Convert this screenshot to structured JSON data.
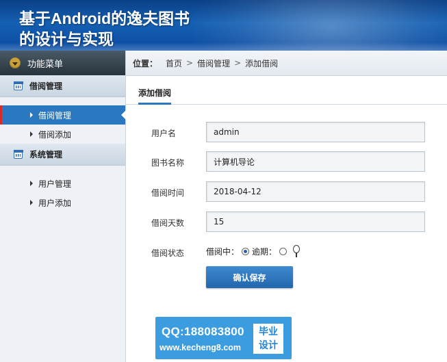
{
  "header": {
    "title_line1": "基于Android的逸夫图书",
    "title_line2": "的设计与实现"
  },
  "sidebar": {
    "menu_title": "功能菜单",
    "groups": [
      {
        "label": "借阅管理",
        "items": [
          {
            "label": "借阅管理",
            "active": true
          },
          {
            "label": "借阅添加"
          }
        ]
      },
      {
        "label": "系统管理",
        "items": [
          {
            "label": "用户管理"
          },
          {
            "label": "用户添加"
          }
        ]
      }
    ]
  },
  "breadcrumb": {
    "position_label": "位置：",
    "items": [
      "首页",
      "借阅管理",
      "添加借阅"
    ],
    "separator": ">"
  },
  "tab": {
    "label": "添加借阅"
  },
  "form": {
    "username": {
      "label": "用户名",
      "value": "admin"
    },
    "book_name": {
      "label": "图书名称",
      "value": "计算机导论"
    },
    "borrow_time": {
      "label": "借阅时间",
      "value": "2018-04-12"
    },
    "borrow_days": {
      "label": "借阅天数",
      "value": "15"
    },
    "status": {
      "label": "借阅状态",
      "option1": "借阅中：",
      "option2": "逾期：",
      "selected": "借阅中"
    },
    "submit_label": "确认保存"
  },
  "watermark": {
    "qq": "QQ:188083800",
    "url": "www.kecheng8.com",
    "badge_line1": "毕业",
    "badge_line2": "设计"
  },
  "colors": {
    "header_blue": "#1560b3",
    "active_item": "#2a78c0",
    "active_marker": "#d42b2b",
    "button": "#2a78c0",
    "watermark": "#3b9de0"
  }
}
